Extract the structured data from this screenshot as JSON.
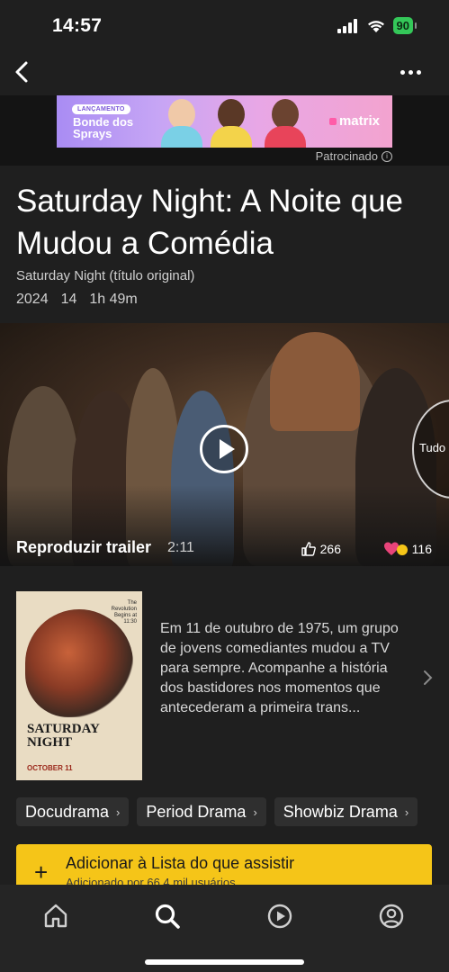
{
  "status_bar": {
    "time": "14:57",
    "battery": "90"
  },
  "nav": {
    "back_icon": "chevron-left-icon",
    "more_icon": "ellipsis-icon"
  },
  "ad": {
    "pill": "LANÇAMENTO",
    "title": "Bonde dos Sprays",
    "brand": "matrix",
    "sponsored_label": "Patrocinado"
  },
  "movie": {
    "title": "Saturday Night: A Noite que Mudou a Comédia",
    "original_title": "Saturday Night (título original)",
    "year": "2024",
    "rating": "14",
    "runtime": "1h 49m"
  },
  "trailer": {
    "label": "Reproduzir trailer",
    "duration": "2:11",
    "likes": "266",
    "loves": "116",
    "side_label": "Tudo"
  },
  "poster": {
    "title_line1": "SATURDAY",
    "title_line2": "NIGHT",
    "date": "OCTOBER 11",
    "tagline": "The Revolution Begins at 11:30"
  },
  "plot": "Em 11 de outubro de 1975, um grupo de jovens comediantes mudou a TV para sempre. Acompanhe a história dos bastidores nos momentos que antecederam a primeira trans...",
  "genres": [
    "Docudrama",
    "Period Drama",
    "Showbiz Drama"
  ],
  "watchlist": {
    "label": "Adicionar à Lista do que assistir",
    "sub": "Adicionado por 66,4 mil usuários"
  },
  "tabs": [
    {
      "icon": "home-icon",
      "active": false
    },
    {
      "icon": "search-icon",
      "active": true
    },
    {
      "icon": "play-circle-icon",
      "active": false
    },
    {
      "icon": "profile-icon",
      "active": false
    }
  ],
  "colors": {
    "accent": "#f5c518",
    "background": "#1f1f1f",
    "battery": "#34c759"
  }
}
